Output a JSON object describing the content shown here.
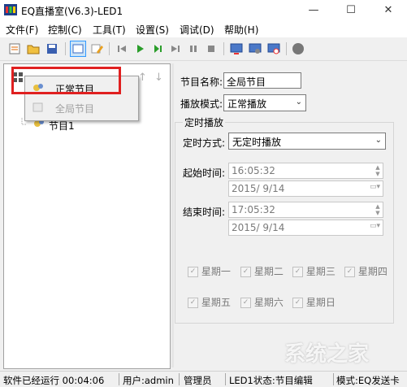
{
  "window": {
    "title": "EQ直播室(V6.3)-LED1",
    "controls": {
      "minimize": "—",
      "maximize": "☐",
      "close": "✕"
    }
  },
  "menu": [
    "文件(F)",
    "控制(C)",
    "工具(T)",
    "设置(S)",
    "调试(D)",
    "帮助(H)"
  ],
  "context_menu": {
    "items": [
      {
        "label": "正常节目",
        "enabled": true
      },
      {
        "label": "全局节目",
        "enabled": false
      }
    ]
  },
  "tree": {
    "node_label": "节目1"
  },
  "program": {
    "name_label": "节目名称",
    "name_value": "全局节目",
    "mode_label": "播放模式",
    "mode_value": "正常播放",
    "timing_group": "定时播放",
    "timing_method_label": "定时方式",
    "timing_method_value": "无定时播放",
    "start_label": "起始时间",
    "start_time": "16:05:32",
    "start_date": "2015/  9/14",
    "end_label": "结束时间",
    "end_time": "17:05:32",
    "end_date": "2015/  9/14",
    "weekdays": [
      "星期一",
      "星期二",
      "星期三",
      "星期四",
      "星期五",
      "星期六",
      "星期日"
    ]
  },
  "status": {
    "runtime": "软件已经运行 00:04:06",
    "user": "用户:admin",
    "role": "管理员",
    "led_state": "LED1状态:节目编辑",
    "mode": "模式:EQ发送卡"
  },
  "watermark": "系统之家",
  "colors": {
    "highlight_border": "#e02020",
    "accent": "#3399ff"
  }
}
